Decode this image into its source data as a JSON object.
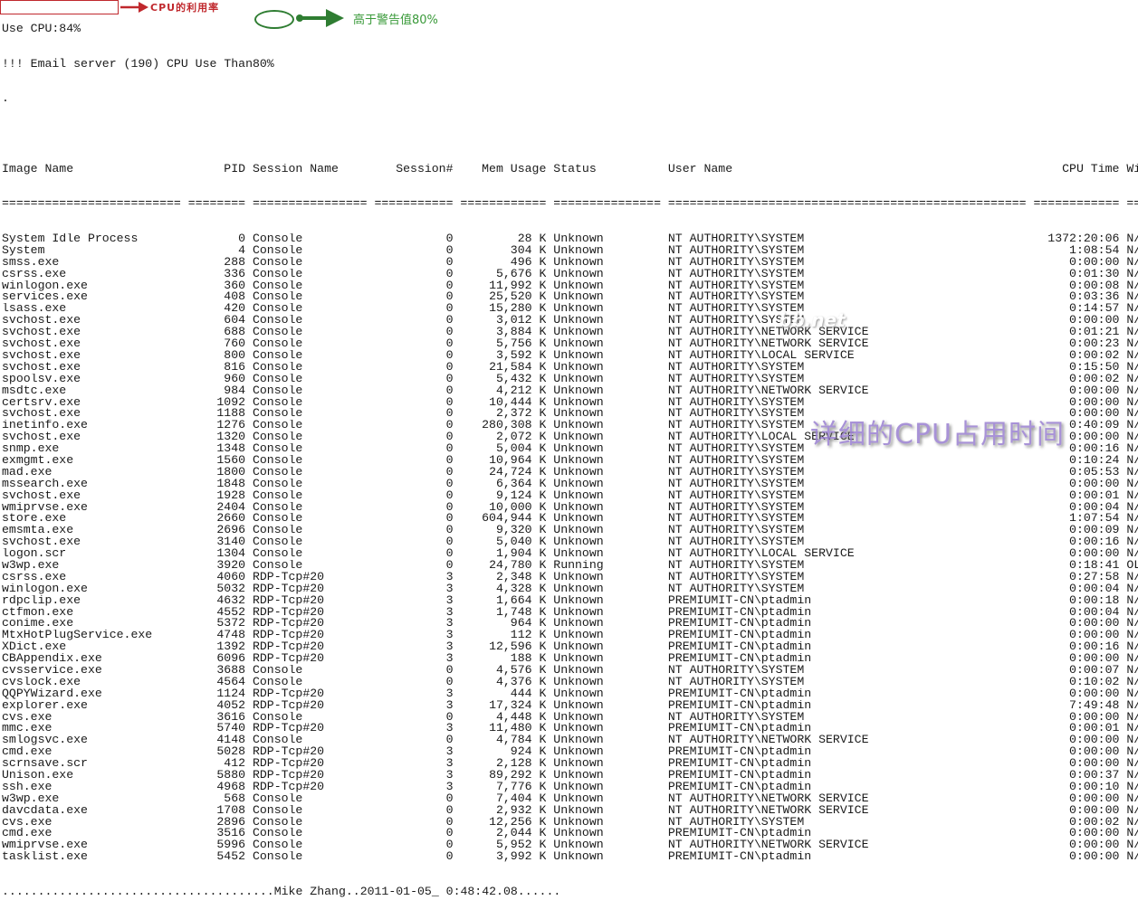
{
  "console": {
    "cpu_line": "Use CPU:84%",
    "alert_line_prefix": "!!! Email server (190) CPU Use Than",
    "alert_threshold": "80%",
    "dot_line": ".",
    "footer": "......................................Mike Zhang..2011-01-05_ 0:48:42.08......"
  },
  "annotations": {
    "cpu_label": "CPU的利用率",
    "threshold_label": "高于警告值80%",
    "detail_label": "详细的CPU占用时间",
    "red": "#c0282d",
    "green": "#2f7d32",
    "purple": "#9a7fd1"
  },
  "watermark": "bb.net",
  "table": {
    "headers": {
      "image_name": "Image Name",
      "pid": "PID",
      "session_name": "Session Name",
      "session_num": "Session#",
      "mem_usage": "Mem Usage",
      "status": "Status",
      "user_name": "User Name",
      "cpu_time": "CPU Time",
      "window_title": "Wi"
    },
    "separators": {
      "image_name": "=========================",
      "pid": "========",
      "session_name": "================",
      "session_num": "===========",
      "mem_usage": "============",
      "status": "===============",
      "user_name": "==================================================",
      "cpu_time": "============",
      "window_title": "=="
    },
    "rows": [
      [
        "System Idle Process",
        "0",
        "Console",
        "0",
        "28 K",
        "Unknown",
        "NT AUTHORITY\\SYSTEM",
        "1372:20:06",
        "N/"
      ],
      [
        "System",
        "4",
        "Console",
        "0",
        "304 K",
        "Unknown",
        "NT AUTHORITY\\SYSTEM",
        "1:08:54",
        "N/"
      ],
      [
        "smss.exe",
        "288",
        "Console",
        "0",
        "496 K",
        "Unknown",
        "NT AUTHORITY\\SYSTEM",
        "0:00:00",
        "N/"
      ],
      [
        "csrss.exe",
        "336",
        "Console",
        "0",
        "5,676 K",
        "Unknown",
        "NT AUTHORITY\\SYSTEM",
        "0:01:30",
        "N/"
      ],
      [
        "winlogon.exe",
        "360",
        "Console",
        "0",
        "11,992 K",
        "Unknown",
        "NT AUTHORITY\\SYSTEM",
        "0:00:08",
        "N/"
      ],
      [
        "services.exe",
        "408",
        "Console",
        "0",
        "25,520 K",
        "Unknown",
        "NT AUTHORITY\\SYSTEM",
        "0:03:36",
        "N/"
      ],
      [
        "lsass.exe",
        "420",
        "Console",
        "0",
        "15,280 K",
        "Unknown",
        "NT AUTHORITY\\SYSTEM",
        "0:14:57",
        "N/"
      ],
      [
        "svchost.exe",
        "604",
        "Console",
        "0",
        "3,012 K",
        "Unknown",
        "NT AUTHORITY\\SYSTEM",
        "0:00:00",
        "N/"
      ],
      [
        "svchost.exe",
        "688",
        "Console",
        "0",
        "3,884 K",
        "Unknown",
        "NT AUTHORITY\\NETWORK SERVICE",
        "0:01:21",
        "N/"
      ],
      [
        "svchost.exe",
        "760",
        "Console",
        "0",
        "5,756 K",
        "Unknown",
        "NT AUTHORITY\\NETWORK SERVICE",
        "0:00:23",
        "N/"
      ],
      [
        "svchost.exe",
        "800",
        "Console",
        "0",
        "3,592 K",
        "Unknown",
        "NT AUTHORITY\\LOCAL SERVICE",
        "0:00:02",
        "N/"
      ],
      [
        "svchost.exe",
        "816",
        "Console",
        "0",
        "21,584 K",
        "Unknown",
        "NT AUTHORITY\\SYSTEM",
        "0:15:50",
        "N/"
      ],
      [
        "spoolsv.exe",
        "960",
        "Console",
        "0",
        "5,432 K",
        "Unknown",
        "NT AUTHORITY\\SYSTEM",
        "0:00:02",
        "N/"
      ],
      [
        "msdtc.exe",
        "984",
        "Console",
        "0",
        "4,212 K",
        "Unknown",
        "NT AUTHORITY\\NETWORK SERVICE",
        "0:00:00",
        "N/"
      ],
      [
        "certsrv.exe",
        "1092",
        "Console",
        "0",
        "10,444 K",
        "Unknown",
        "NT AUTHORITY\\SYSTEM",
        "0:00:00",
        "N/"
      ],
      [
        "svchost.exe",
        "1188",
        "Console",
        "0",
        "2,372 K",
        "Unknown",
        "NT AUTHORITY\\SYSTEM",
        "0:00:00",
        "N/"
      ],
      [
        "inetinfo.exe",
        "1276",
        "Console",
        "0",
        "280,308 K",
        "Unknown",
        "NT AUTHORITY\\SYSTEM",
        "0:40:09",
        "N/"
      ],
      [
        "svchost.exe",
        "1320",
        "Console",
        "0",
        "2,072 K",
        "Unknown",
        "NT AUTHORITY\\LOCAL SERVICE",
        "0:00:00",
        "N/"
      ],
      [
        "snmp.exe",
        "1348",
        "Console",
        "0",
        "5,004 K",
        "Unknown",
        "NT AUTHORITY\\SYSTEM",
        "0:00:16",
        "N/"
      ],
      [
        "exmgmt.exe",
        "1560",
        "Console",
        "0",
        "10,964 K",
        "Unknown",
        "NT AUTHORITY\\SYSTEM",
        "0:10:24",
        "N/"
      ],
      [
        "mad.exe",
        "1800",
        "Console",
        "0",
        "24,724 K",
        "Unknown",
        "NT AUTHORITY\\SYSTEM",
        "0:05:53",
        "N/"
      ],
      [
        "mssearch.exe",
        "1848",
        "Console",
        "0",
        "6,364 K",
        "Unknown",
        "NT AUTHORITY\\SYSTEM",
        "0:00:00",
        "N/"
      ],
      [
        "svchost.exe",
        "1928",
        "Console",
        "0",
        "9,124 K",
        "Unknown",
        "NT AUTHORITY\\SYSTEM",
        "0:00:01",
        "N/"
      ],
      [
        "wmiprvse.exe",
        "2404",
        "Console",
        "0",
        "10,000 K",
        "Unknown",
        "NT AUTHORITY\\SYSTEM",
        "0:00:04",
        "N/"
      ],
      [
        "store.exe",
        "2660",
        "Console",
        "0",
        "604,944 K",
        "Unknown",
        "NT AUTHORITY\\SYSTEM",
        "1:07:54",
        "N/"
      ],
      [
        "emsmta.exe",
        "2696",
        "Console",
        "0",
        "9,320 K",
        "Unknown",
        "NT AUTHORITY\\SYSTEM",
        "0:00:09",
        "N/"
      ],
      [
        "svchost.exe",
        "3140",
        "Console",
        "0",
        "5,040 K",
        "Unknown",
        "NT AUTHORITY\\SYSTEM",
        "0:00:16",
        "N/"
      ],
      [
        "logon.scr",
        "1304",
        "Console",
        "0",
        "1,904 K",
        "Unknown",
        "NT AUTHORITY\\LOCAL SERVICE",
        "0:00:00",
        "N/"
      ],
      [
        "w3wp.exe",
        "3920",
        "Console",
        "0",
        "24,780 K",
        "Running",
        "NT AUTHORITY\\SYSTEM",
        "0:18:41",
        "OL"
      ],
      [
        "csrss.exe",
        "4060",
        "RDP-Tcp#20",
        "3",
        "2,348 K",
        "Unknown",
        "NT AUTHORITY\\SYSTEM",
        "0:27:58",
        "N/"
      ],
      [
        "winlogon.exe",
        "5032",
        "RDP-Tcp#20",
        "3",
        "4,328 K",
        "Unknown",
        "NT AUTHORITY\\SYSTEM",
        "0:00:04",
        "N/"
      ],
      [
        "rdpclip.exe",
        "4632",
        "RDP-Tcp#20",
        "3",
        "1,664 K",
        "Unknown",
        "PREMIUMIT-CN\\ptadmin",
        "0:00:18",
        "N/"
      ],
      [
        "ctfmon.exe",
        "4552",
        "RDP-Tcp#20",
        "3",
        "1,748 K",
        "Unknown",
        "PREMIUMIT-CN\\ptadmin",
        "0:00:04",
        "N/"
      ],
      [
        "conime.exe",
        "5372",
        "RDP-Tcp#20",
        "3",
        "964 K",
        "Unknown",
        "PREMIUMIT-CN\\ptadmin",
        "0:00:00",
        "N/"
      ],
      [
        "MtxHotPlugService.exe",
        "4748",
        "RDP-Tcp#20",
        "3",
        "112 K",
        "Unknown",
        "PREMIUMIT-CN\\ptadmin",
        "0:00:00",
        "N/"
      ],
      [
        "XDict.exe",
        "1392",
        "RDP-Tcp#20",
        "3",
        "12,596 K",
        "Unknown",
        "PREMIUMIT-CN\\ptadmin",
        "0:00:16",
        "N/"
      ],
      [
        "CBAppendix.exe",
        "6096",
        "RDP-Tcp#20",
        "3",
        "188 K",
        "Unknown",
        "PREMIUMIT-CN\\ptadmin",
        "0:00:00",
        "N/"
      ],
      [
        "cvsservice.exe",
        "3688",
        "Console",
        "0",
        "4,576 K",
        "Unknown",
        "NT AUTHORITY\\SYSTEM",
        "0:00:07",
        "N/"
      ],
      [
        "cvslock.exe",
        "4564",
        "Console",
        "0",
        "4,376 K",
        "Unknown",
        "NT AUTHORITY\\SYSTEM",
        "0:10:02",
        "N/"
      ],
      [
        "QQPYWizard.exe",
        "1124",
        "RDP-Tcp#20",
        "3",
        "444 K",
        "Unknown",
        "PREMIUMIT-CN\\ptadmin",
        "0:00:00",
        "N/"
      ],
      [
        "explorer.exe",
        "4052",
        "RDP-Tcp#20",
        "3",
        "17,324 K",
        "Unknown",
        "PREMIUMIT-CN\\ptadmin",
        "7:49:48",
        "N/"
      ],
      [
        "cvs.exe",
        "3616",
        "Console",
        "0",
        "4,448 K",
        "Unknown",
        "NT AUTHORITY\\SYSTEM",
        "0:00:00",
        "N/"
      ],
      [
        "mmc.exe",
        "5740",
        "RDP-Tcp#20",
        "3",
        "11,480 K",
        "Unknown",
        "PREMIUMIT-CN\\ptadmin",
        "0:00:01",
        "N/"
      ],
      [
        "smlogsvc.exe",
        "4148",
        "Console",
        "0",
        "4,784 K",
        "Unknown",
        "NT AUTHORITY\\NETWORK SERVICE",
        "0:00:00",
        "N/"
      ],
      [
        "cmd.exe",
        "5028",
        "RDP-Tcp#20",
        "3",
        "924 K",
        "Unknown",
        "PREMIUMIT-CN\\ptadmin",
        "0:00:00",
        "N/"
      ],
      [
        "scrnsave.scr",
        "412",
        "RDP-Tcp#20",
        "3",
        "2,128 K",
        "Unknown",
        "PREMIUMIT-CN\\ptadmin",
        "0:00:00",
        "N/"
      ],
      [
        "Unison.exe",
        "5880",
        "RDP-Tcp#20",
        "3",
        "89,292 K",
        "Unknown",
        "PREMIUMIT-CN\\ptadmin",
        "0:00:37",
        "N/"
      ],
      [
        "ssh.exe",
        "4968",
        "RDP-Tcp#20",
        "3",
        "7,776 K",
        "Unknown",
        "PREMIUMIT-CN\\ptadmin",
        "0:00:10",
        "N/"
      ],
      [
        "w3wp.exe",
        "568",
        "Console",
        "0",
        "7,404 K",
        "Unknown",
        "NT AUTHORITY\\NETWORK SERVICE",
        "0:00:00",
        "N/"
      ],
      [
        "davcdata.exe",
        "1708",
        "Console",
        "0",
        "2,932 K",
        "Unknown",
        "NT AUTHORITY\\NETWORK SERVICE",
        "0:00:00",
        "N/"
      ],
      [
        "cvs.exe",
        "2896",
        "Console",
        "0",
        "12,256 K",
        "Unknown",
        "NT AUTHORITY\\SYSTEM",
        "0:00:02",
        "N/"
      ],
      [
        "cmd.exe",
        "3516",
        "Console",
        "0",
        "2,044 K",
        "Unknown",
        "PREMIUMIT-CN\\ptadmin",
        "0:00:00",
        "N/"
      ],
      [
        "wmiprvse.exe",
        "5996",
        "Console",
        "0",
        "5,952 K",
        "Unknown",
        "NT AUTHORITY\\NETWORK SERVICE",
        "0:00:00",
        "N/"
      ],
      [
        "tasklist.exe",
        "5452",
        "Console",
        "0",
        "3,992 K",
        "Unknown",
        "PREMIUMIT-CN\\ptadmin",
        "0:00:00",
        "N/"
      ]
    ]
  }
}
